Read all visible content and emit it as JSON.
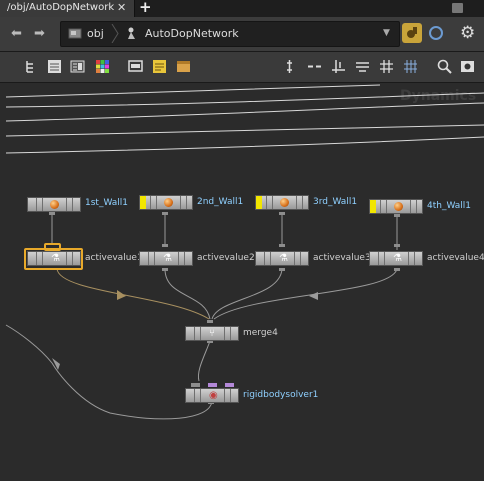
{
  "tab": {
    "title": "/obj/AutoDopNetwork",
    "close": "✕",
    "add": "+"
  },
  "path": {
    "back": "⬅",
    "forward": "➡",
    "crumbs": [
      "obj",
      "AutoDopNetwork"
    ],
    "dropdown": "▼"
  },
  "toolbar": {
    "left_icons": [
      "tree-icon",
      "list-icon",
      "params-icon",
      "color-palette-icon",
      "screen-icon",
      "sticky-note-icon",
      "box-icon"
    ],
    "right_icons": [
      "align-icon",
      "dash-icon",
      "snap-icon",
      "layout-icon",
      "grid-icon",
      "grid-alt-icon",
      "search-icon",
      "eye-icon"
    ]
  },
  "graph": {
    "context_label": "Dynamics",
    "nodes": [
      {
        "label": "1st_Wall1",
        "kind": "object",
        "flag": false
      },
      {
        "label": "2nd_Wall1",
        "kind": "object",
        "flag": true
      },
      {
        "label": "3rd_Wall1",
        "kind": "object",
        "flag": true
      },
      {
        "label": "4th_Wall1",
        "kind": "object",
        "flag": true
      },
      {
        "label": "activevalue1",
        "kind": "activevalue",
        "selected": true
      },
      {
        "label": "activevalue2",
        "kind": "activevalue"
      },
      {
        "label": "activevalue3",
        "kind": "activevalue"
      },
      {
        "label": "activevalue4",
        "kind": "activevalue"
      },
      {
        "label": "merge4",
        "kind": "merge"
      },
      {
        "label": "rigidbodysolver1",
        "kind": "solver"
      }
    ]
  },
  "colors": {
    "flag": "#f2e600",
    "selection": "#e8a92a",
    "object_label": "#8fd0ff",
    "wire": "#8d8d8d",
    "selected_wire": "#a89060"
  }
}
